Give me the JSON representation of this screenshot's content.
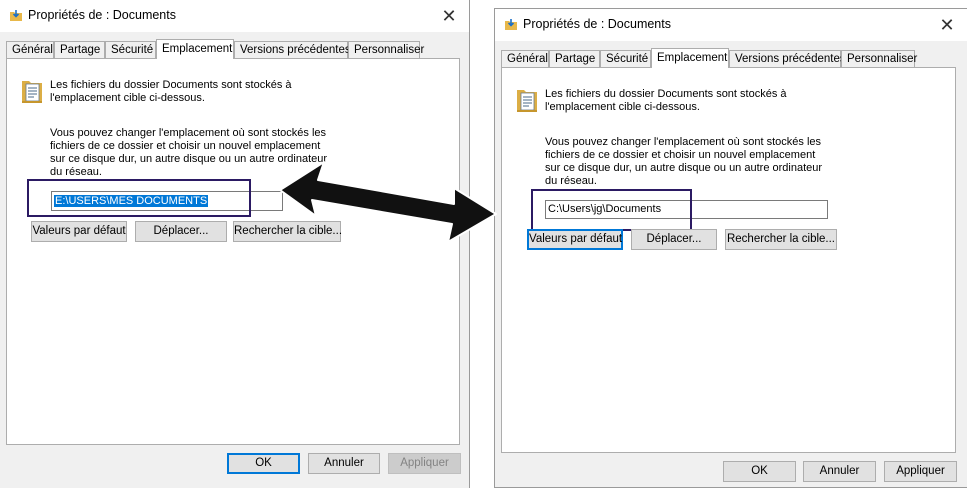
{
  "dialog": {
    "title": "Propriétés de : Documents",
    "close_glyph": "✕",
    "tabs": [
      {
        "label": "Général"
      },
      {
        "label": "Partage"
      },
      {
        "label": "Sécurité"
      },
      {
        "label": "Emplacement"
      },
      {
        "label": "Versions précédentes"
      },
      {
        "label": "Personnaliser"
      }
    ],
    "active_tab": "Emplacement",
    "info_text": "Les fichiers du dossier Documents sont stockés à l'emplacement cible ci-dessous.",
    "description": "Vous pouvez changer l'emplacement où sont stockés les fichiers de ce dossier et choisir un nouvel emplacement sur ce disque dur, un autre disque ou un autre ordinateur du réseau.",
    "buttons": {
      "restore_default": "Valeurs par défaut",
      "move": "Déplacer...",
      "find_target": "Rechercher la cible...",
      "ok": "OK",
      "cancel": "Annuler",
      "apply": "Appliquer"
    }
  },
  "left": {
    "path_value": "E:\\USERS\\MES DOCUMENTS",
    "path_selected": true
  },
  "right": {
    "path_value": "C:\\Users\\jg\\Documents"
  },
  "colors": {
    "selection": "#0078d7",
    "annotation": "#2b1a63",
    "arrow": "#111111"
  },
  "icons": {
    "title": "folder-download-icon",
    "folder": "documents-folder-icon",
    "arrow": "double-headed-arrow-icon"
  }
}
